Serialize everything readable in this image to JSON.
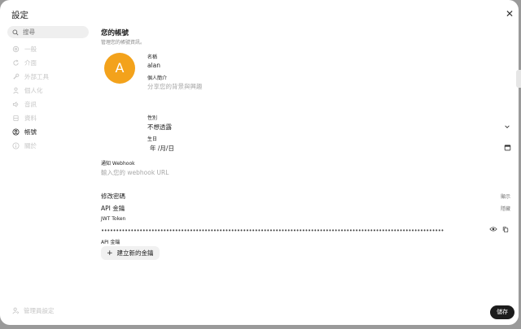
{
  "window": {
    "title": "設定"
  },
  "sidebar": {
    "search": {
      "placeholder": "搜尋"
    },
    "items": [
      {
        "label": "一般",
        "icon": "gear-icon",
        "active": false
      },
      {
        "label": "介面",
        "icon": "refresh-icon",
        "active": false
      },
      {
        "label": "外部工具",
        "icon": "wrench-icon",
        "active": false
      },
      {
        "label": "個人化",
        "icon": "person-icon",
        "active": false
      },
      {
        "label": "音訊",
        "icon": "speaker-icon",
        "active": false
      },
      {
        "label": "資料",
        "icon": "database-icon",
        "active": false
      },
      {
        "label": "帳號",
        "icon": "user-circle-icon",
        "active": true
      },
      {
        "label": "關於",
        "icon": "info-icon",
        "active": false
      }
    ],
    "admin_label": "管理員設定"
  },
  "account": {
    "title": "您的帳號",
    "subtitle": "管理您的帳號資訊。",
    "avatar_letter": "A",
    "name_label": "名稱",
    "name_value": "alan",
    "bio_label": "個人簡介",
    "bio_placeholder": "分享您的背景與興趣",
    "gender_label": "性別",
    "gender_value": "不想透露",
    "birthday_label": "生日",
    "birthday_placeholder": "年 /月/日",
    "webhook_label": "通知 Webhook",
    "webhook_placeholder": "輸入您的 webhook URL",
    "change_password_label": "修改密碼",
    "change_password_action": "顯示",
    "api_keys_label": "API 金鑰",
    "api_keys_action": "隱藏",
    "jwt_label": "JWT Token",
    "jwt_dots": "••••••••••••••••••••••••••••••••••••••••••••••••••••••••••••••••••••••••••••••••••••••••••••••••••••••••••••••••••••",
    "api_key_label": "API 金鑰",
    "create_key_button": "建立新的金鑰",
    "save_button": "儲存"
  },
  "colors": {
    "avatar_bg": "#f3a21b",
    "save_bg": "#1c1c1c",
    "inactive_text": "#c7c7c7"
  }
}
